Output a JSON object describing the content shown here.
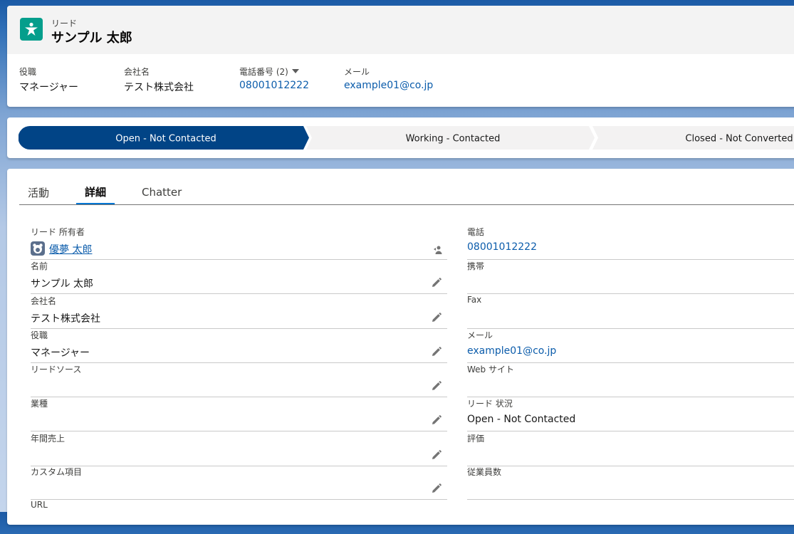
{
  "header": {
    "object_label": "リード",
    "record_name": "サンプル 太郎",
    "icon": "lead-icon",
    "fields": [
      {
        "label": "役職",
        "value": "マネージャー"
      },
      {
        "label": "会社名",
        "value": "テスト株式会社"
      },
      {
        "label": "電話番号 (2)",
        "value": "08001012222"
      },
      {
        "label": "メール",
        "value": "example01@co.jp"
      }
    ]
  },
  "path": {
    "steps": [
      "Open - Not Contacted",
      "Working - Contacted",
      "Closed - Not Converted"
    ],
    "current_index": 0,
    "current_color": "#014486",
    "inactive_color": "#f3f2f2"
  },
  "tabs": [
    {
      "label": "活動",
      "active": false
    },
    {
      "label": "詳細",
      "active": true
    },
    {
      "label": "Chatter",
      "active": false
    }
  ],
  "details": {
    "left": [
      {
        "label": "リード 所有者",
        "value": "優夢 太郎"
      },
      {
        "label": "名前",
        "value": "サンプル 太郎"
      },
      {
        "label": "会社名",
        "value": "テスト株式会社"
      },
      {
        "label": "役職",
        "value": "マネージャー"
      },
      {
        "label": "リードソース",
        "value": ""
      },
      {
        "label": "業種",
        "value": ""
      },
      {
        "label": "年間売上",
        "value": ""
      },
      {
        "label": "カスタム項目",
        "value": ""
      },
      {
        "label": "URL",
        "value": ""
      }
    ],
    "right": [
      {
        "label": "電話",
        "value": "08001012222"
      },
      {
        "label": "携帯",
        "value": ""
      },
      {
        "label": "Fax",
        "value": ""
      },
      {
        "label": "メール",
        "value": "example01@co.jp"
      },
      {
        "label": "Web サイト",
        "value": ""
      },
      {
        "label": "リード 状況",
        "value": "Open - Not Contacted"
      },
      {
        "label": "評価",
        "value": ""
      },
      {
        "label": "従業員数",
        "value": ""
      }
    ]
  },
  "colors": {
    "brand_blue": "#0176d3",
    "link": "#0b5cab",
    "lead_icon_bg": "#049e8c"
  }
}
